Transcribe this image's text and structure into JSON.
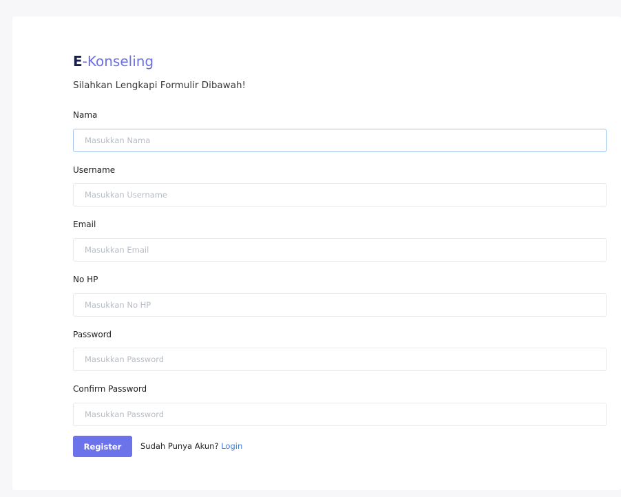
{
  "brand": {
    "strong": "E",
    "rest": "-Konseling"
  },
  "subtitle": "Silahkan Lengkapi Formulir Dibawah!",
  "fields": [
    {
      "label": "Nama",
      "placeholder": "Masukkan Nama",
      "value": ""
    },
    {
      "label": "Username",
      "placeholder": "Masukkan Username",
      "value": ""
    },
    {
      "label": "Email",
      "placeholder": "Masukkan Email",
      "value": ""
    },
    {
      "label": "No HP",
      "placeholder": "Masukkan No HP",
      "value": ""
    },
    {
      "label": "Password",
      "placeholder": "Masukkan Password",
      "value": ""
    },
    {
      "label": "Confirm Password",
      "placeholder": "Masukkan Password",
      "value": ""
    }
  ],
  "actions": {
    "register_label": "Register",
    "login_prompt": "Sudah Punya Akun?",
    "login_link": "Login"
  },
  "colors": {
    "brand_dark": "#1a1f4b",
    "brand_accent": "#6c70e5",
    "button": "#6c72ea",
    "link": "#3d7fe0",
    "focus_border": "#9fc3ea"
  }
}
